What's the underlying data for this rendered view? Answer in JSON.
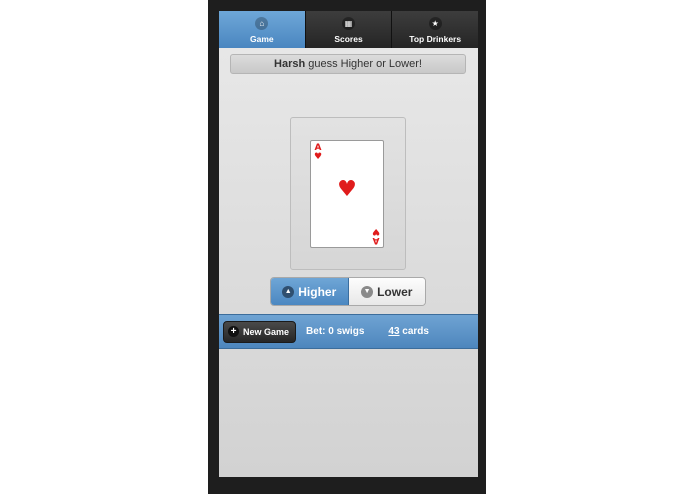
{
  "nav": {
    "tabs": [
      {
        "label": "Game",
        "icon": "home-icon",
        "active": true
      },
      {
        "label": "Scores",
        "icon": "grid-icon",
        "active": false
      },
      {
        "label": "Top Drinkers",
        "icon": "star-icon",
        "active": false
      }
    ]
  },
  "prompt": {
    "player": "Harsh",
    "text": "guess Higher or Lower!"
  },
  "card": {
    "rank": "A",
    "suit": "♥",
    "color": "#e01b1b"
  },
  "choices": {
    "higher_label": "Higher",
    "lower_label": "Lower"
  },
  "footer": {
    "new_game_label": "New Game",
    "bet_text": "Bet: 0 swigs",
    "cards_count": "43",
    "cards_label": " cards"
  },
  "colors": {
    "accent": "#4a86c0",
    "frame": "#1e1e1e"
  }
}
